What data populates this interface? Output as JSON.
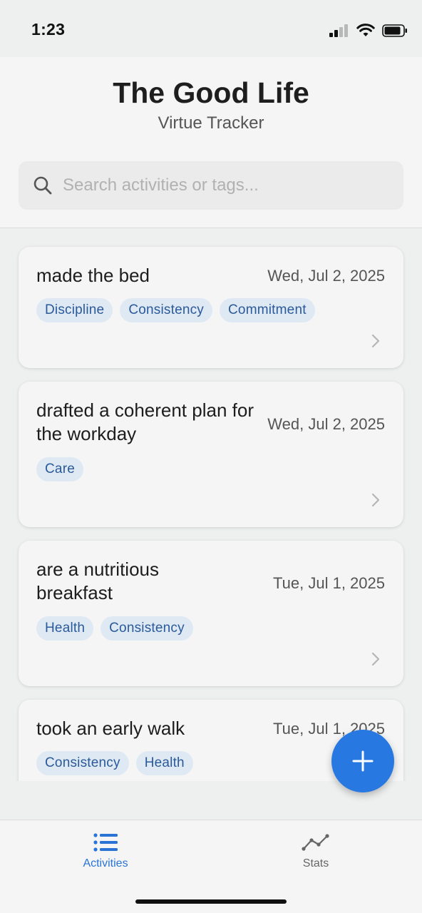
{
  "status_bar": {
    "time": "1:23"
  },
  "header": {
    "title": "The Good Life",
    "subtitle": "Virtue Tracker"
  },
  "search": {
    "placeholder": "Search activities or tags...",
    "value": ""
  },
  "activities": [
    {
      "title": "made the bed",
      "date": "Wed, Jul 2, 2025",
      "tags": [
        "Discipline",
        "Consistency",
        "Commitment"
      ]
    },
    {
      "title": "drafted a coherent plan for the workday",
      "date": "Wed, Jul 2, 2025",
      "tags": [
        "Care"
      ]
    },
    {
      "title": "are a nutritious breakfast",
      "date": "Tue, Jul 1, 2025",
      "tags": [
        "Health",
        "Consistency"
      ]
    },
    {
      "title": "took an early walk",
      "date": "Tue, Jul 1, 2025",
      "tags": [
        "Consistency",
        "Health"
      ]
    }
  ],
  "fab": {
    "icon": "plus-icon"
  },
  "tabbar": {
    "tabs": [
      {
        "label": "Activities",
        "icon": "list-icon",
        "active": true
      },
      {
        "label": "Stats",
        "icon": "line-chart-icon",
        "active": false
      }
    ]
  },
  "colors": {
    "accent": "#2878e2",
    "tag_bg": "#dfe9f4",
    "tag_text": "#2a5a99",
    "active_tab": "#2a74d6",
    "inactive_tab": "#666666"
  }
}
